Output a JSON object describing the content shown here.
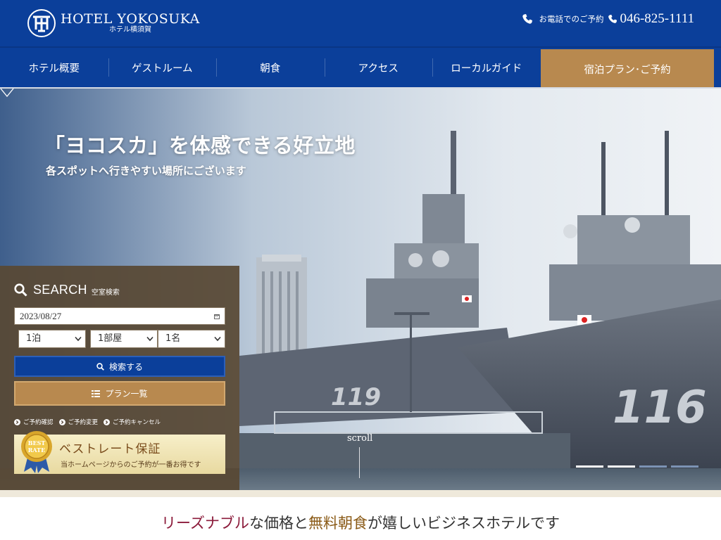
{
  "header": {
    "logo_en": "HOTEL YOKOSUKA",
    "logo_jp": "ホテル横須賀",
    "phone_label": "お電話でのご予約",
    "phone_number": "046-825-1111"
  },
  "nav": {
    "items": [
      "ホテル概要",
      "ゲストルーム",
      "朝食",
      "アクセス",
      "ローカルガイド"
    ],
    "cta": "宿泊プラン･ご予約"
  },
  "hero": {
    "title": "「ヨコスカ」を体感できる好立地",
    "subtitle": "各スポットへ行きやすい場所にございます",
    "scroll": "scroll",
    "ship_number_front": "116",
    "ship_number_back": "119"
  },
  "search": {
    "title": "SEARCH",
    "subtitle": "空室検索",
    "date": "2023/08/27",
    "nights": "1泊",
    "rooms": "1部屋",
    "guests": "1名",
    "search_button": "検索する",
    "plan_button": "プラン一覧",
    "links": [
      "ご予約確認",
      "ご予約変更",
      "ご予約キャンセル"
    ],
    "best_rate": {
      "badge_line1": "BEST",
      "badge_line2": "RATE",
      "title": "ベストレート保証",
      "subtitle": "当ホームページからのご予約が一番お得です"
    }
  },
  "tagline": {
    "part1": "リーズナブル",
    "part2": "な価格と",
    "part3": "無料朝食",
    "part4": "が嬉しいビジネスホテルです"
  },
  "colors": {
    "brand_blue": "#0b3f9a",
    "accent_gold": "#b8894f",
    "tag_red": "#8b1a3a",
    "tag_brown": "#8a5a16"
  }
}
